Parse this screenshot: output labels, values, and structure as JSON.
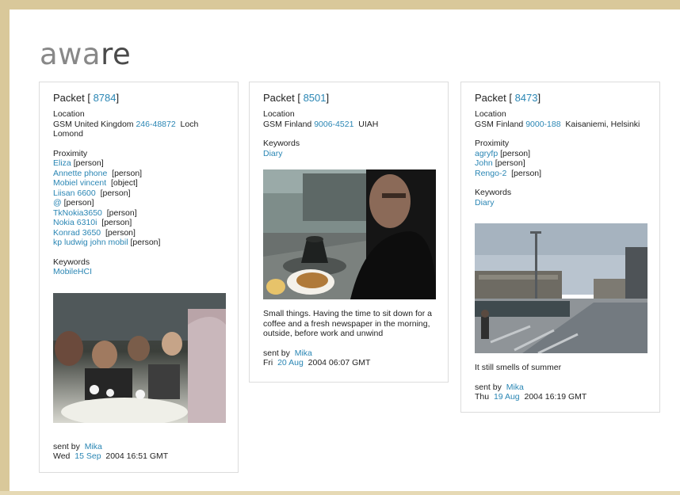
{
  "logo": {
    "light": "awa",
    "dark": "re"
  },
  "packets": [
    {
      "title_prefix": "Packet [ ",
      "id": "8784",
      "title_suffix": "]",
      "location_label": "Location",
      "location_network": "GSM United Kingdom",
      "location_cell": "246-48872",
      "location_name": "Loch Lomond",
      "proximity_label": "Proximity",
      "proximity": [
        {
          "name": "Eliza",
          "type": "[person]"
        },
        {
          "name": "Annette phone",
          "type": "[person]"
        },
        {
          "name": "Mobiel vincent",
          "type": "[object]"
        },
        {
          "name": "Liisan 6600",
          "type": "[person]"
        },
        {
          "name": "@",
          "type": "[person]"
        },
        {
          "name": "TkNokia3650",
          "type": "[person]"
        },
        {
          "name": "Nokia 6310i",
          "type": "[person]"
        },
        {
          "name": "Konrad 3650",
          "type": "[person]"
        },
        {
          "name": "kp ludwig john mobil",
          "type": "[person]"
        }
      ],
      "keywords_label": "Keywords",
      "keyword": "MobileHCI",
      "photo_scene": "restaurant-dinner-photo",
      "sent_by_label": "sent by",
      "sender": "Mika",
      "date_day": "Wed",
      "date_link": "15 Sep",
      "date_rest": "2004 16:51 GMT"
    },
    {
      "title_prefix": "Packet [ ",
      "id": "8501",
      "title_suffix": "]",
      "location_label": "Location",
      "location_network": "GSM Finland",
      "location_cell": "9006-4521",
      "location_name": "UIAH",
      "keywords_label": "Keywords",
      "keyword": "Diary",
      "photo_scene": "cafe-selfie-photo",
      "caption": "Small things. Having the time to sit down for a coffee and a fresh newspaper in the morning, outside, before work and unwind",
      "sent_by_label": "sent by",
      "sender": "Mika",
      "date_day": "Fri",
      "date_link": "20 Aug",
      "date_rest": "2004 06:07 GMT"
    },
    {
      "title_prefix": "Packet [ ",
      "id": "8473",
      "title_suffix": "]",
      "location_label": "Location",
      "location_network": "GSM Finland",
      "location_cell": "9000-188",
      "location_name": "Kaisaniemi, Helsinki",
      "proximity_label": "Proximity",
      "proximity": [
        {
          "name": "agryfp",
          "type": "[person]"
        },
        {
          "name": "John",
          "type": "[person]"
        },
        {
          "name": "Rengo-2",
          "type": "[person]"
        }
      ],
      "keywords_label": "Keywords",
      "keyword": "Diary",
      "photo_scene": "city-street-photo",
      "caption": "It still smells of summer",
      "sent_by_label": "sent by",
      "sender": "Mika",
      "date_day": "Thu",
      "date_link": "19 Aug",
      "date_rest": "2004 16:19 GMT"
    }
  ],
  "colors": {
    "link": "#2a86b4",
    "frame": "#d9c89a",
    "border": "#dcdcdc"
  }
}
